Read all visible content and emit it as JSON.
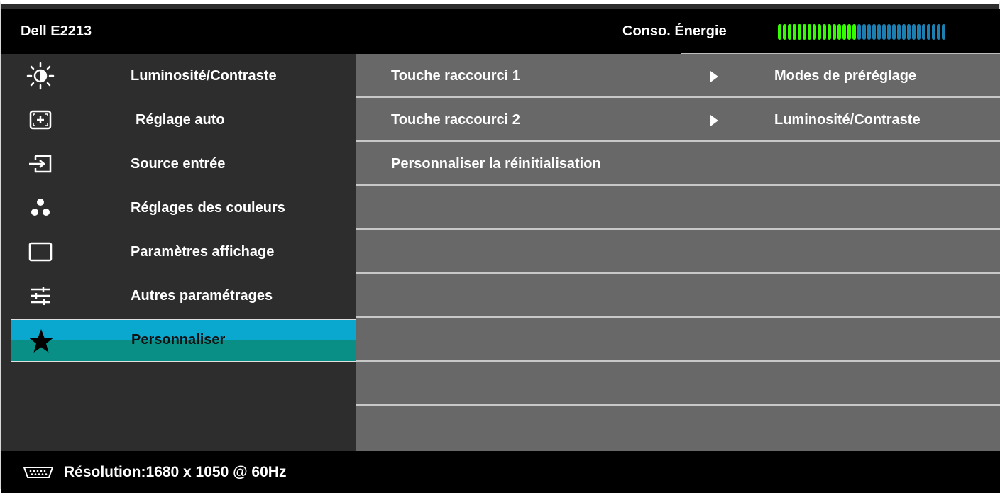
{
  "header": {
    "model": "Dell E2213",
    "power_label": "Conso. Énergie",
    "power_level": 0.47,
    "power_colors": {
      "active": "#33ff00",
      "inactive": "#1c7fb0"
    }
  },
  "menu": {
    "items": [
      {
        "label": "Luminosité/Contraste",
        "icon": "brightness-contrast-icon"
      },
      {
        "label": "Réglage auto",
        "icon": "auto-adjust-icon"
      },
      {
        "label": "Source entrée",
        "icon": "input-source-icon"
      },
      {
        "label": "Réglages des couleurs",
        "icon": "color-settings-icon"
      },
      {
        "label": "Paramètres affichage",
        "icon": "display-settings-icon"
      },
      {
        "label": "Autres paramétrages",
        "icon": "other-settings-icon"
      },
      {
        "label": "Personnaliser",
        "icon": "star-icon"
      }
    ],
    "selected_index": 6
  },
  "submenu": {
    "rows": [
      {
        "label": "Touche raccourci 1",
        "value": "Modes de préréglage",
        "has_arrow": true
      },
      {
        "label": "Touche raccourci 2",
        "value": "Luminosité/Contraste",
        "has_arrow": true
      },
      {
        "label": "Personnaliser la réinitialisation",
        "value": "",
        "has_arrow": false
      }
    ]
  },
  "footer": {
    "connector_icon": "vga-connector-icon",
    "resolution": "Résolution:1680 x 1050 @ 60Hz"
  },
  "colors": {
    "selected_top": "#0aa8cf",
    "selected_bottom": "#0a8f86",
    "left_panel": "#2d2d2d",
    "right_panel": "#686868"
  }
}
